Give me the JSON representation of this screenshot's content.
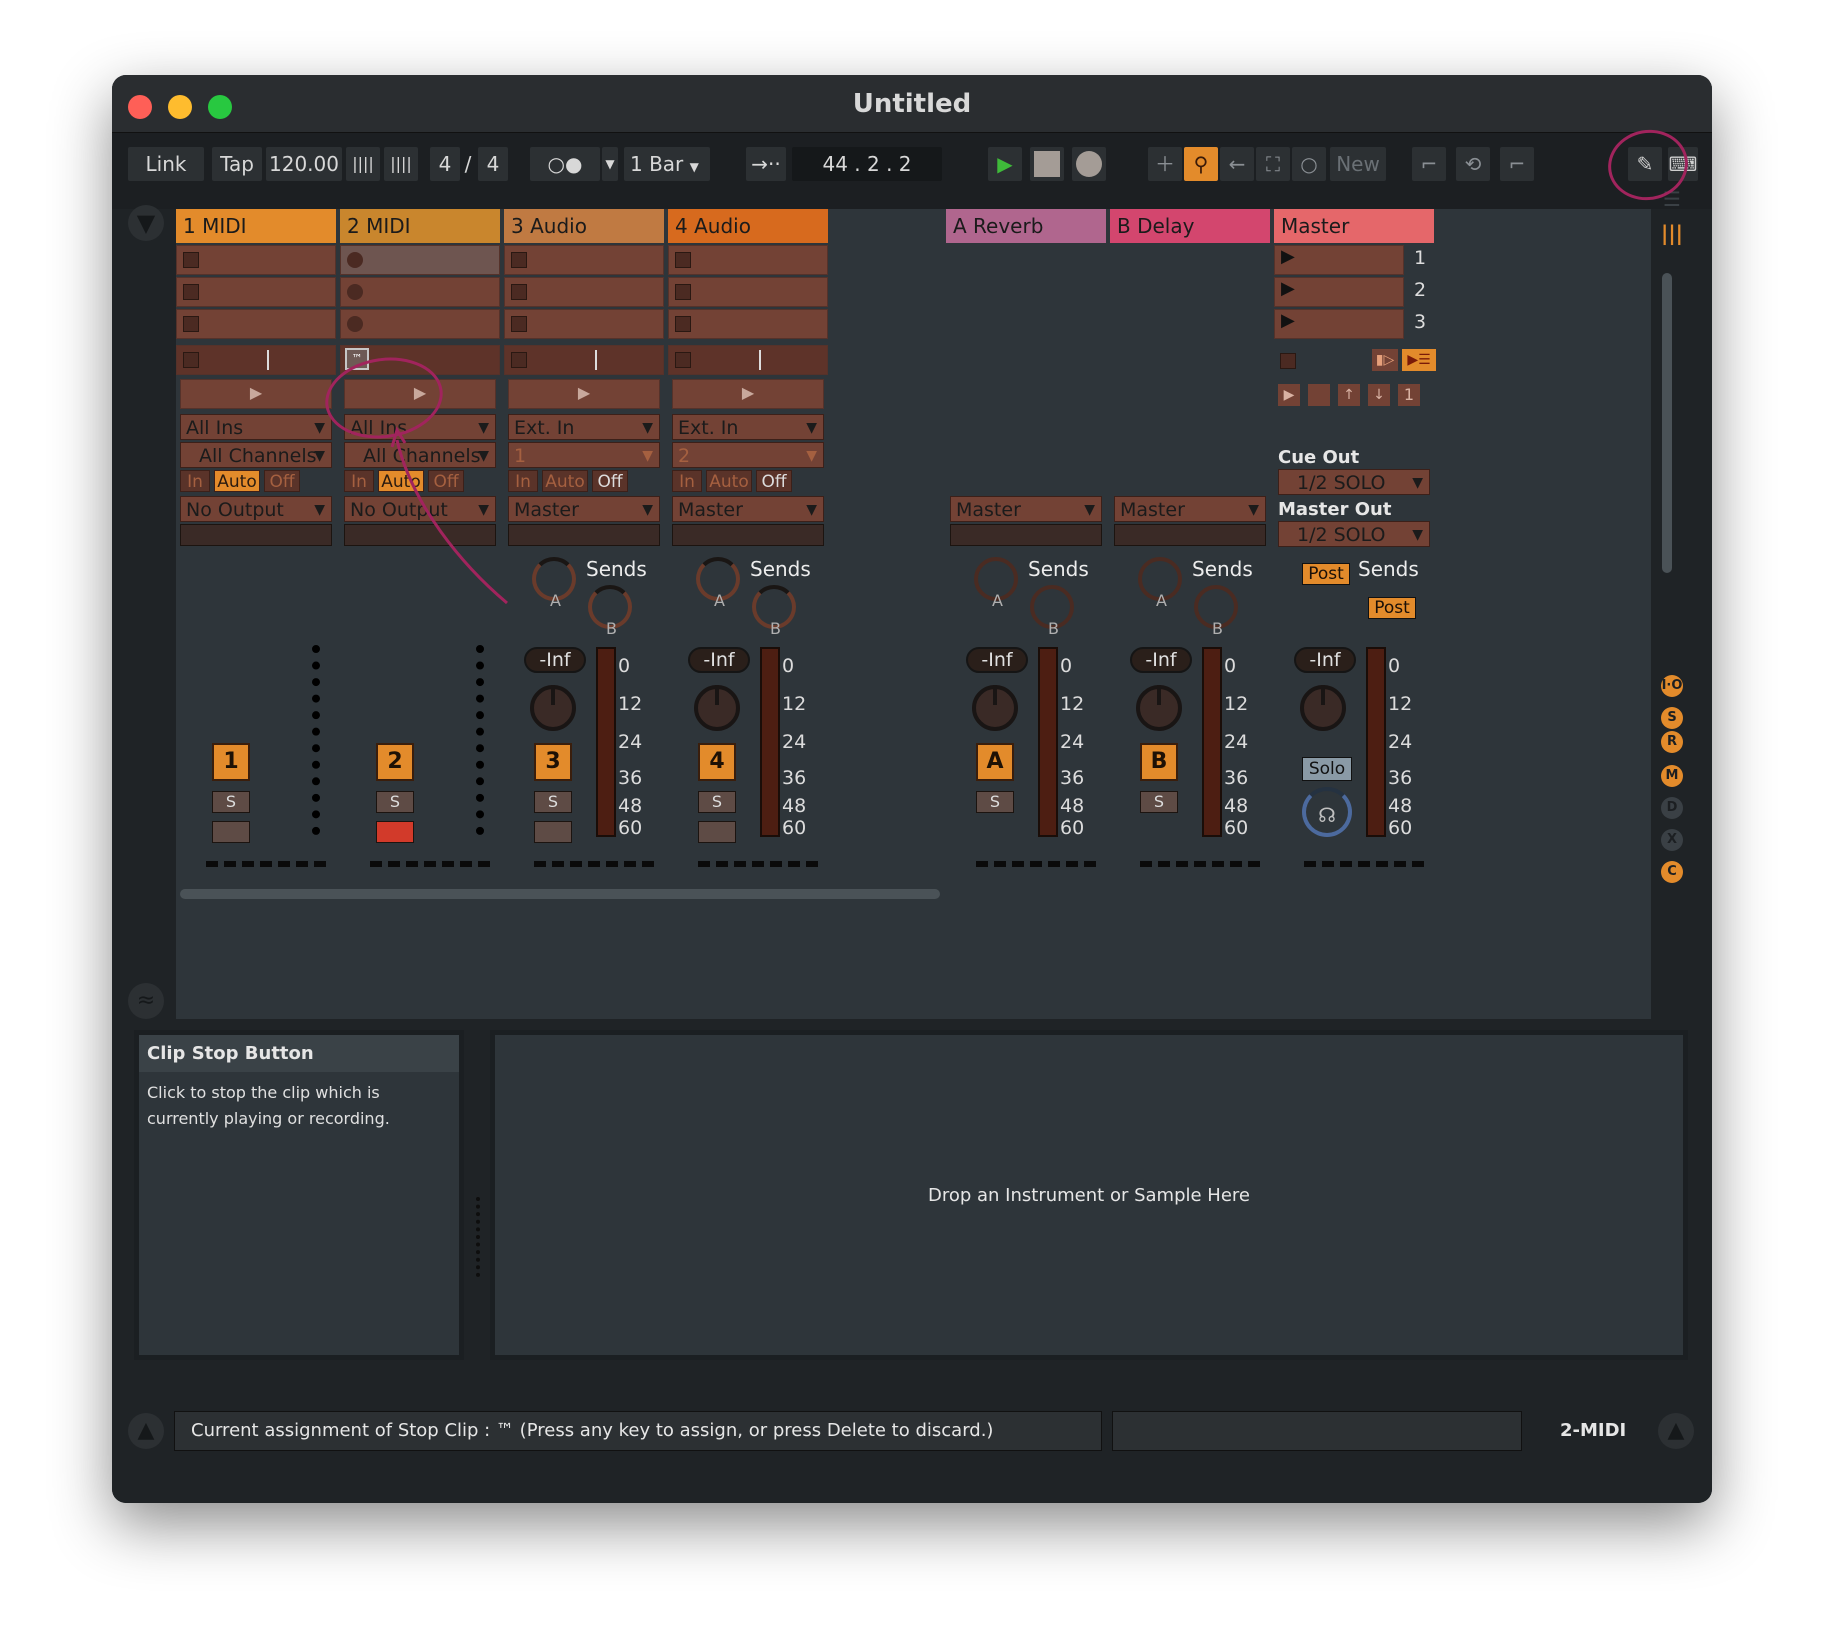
{
  "window": {
    "title": "Untitled"
  },
  "control_bar": {
    "link": "Link",
    "tap": "Tap",
    "tempo": "120.00",
    "time_sig_num": "4",
    "time_sig_sep": "/",
    "time_sig_den": "4",
    "quantize": "1 Bar",
    "position": "44 .   2 .   2",
    "new_label": "New"
  },
  "tracks": [
    {
      "name": "1 MIDI",
      "color": "#e38b2b",
      "input": "All Ins",
      "channel": "All Channels",
      "output": "No Output",
      "number": "1"
    },
    {
      "name": "2 MIDI",
      "color": "#c9862d",
      "input": "All Ins",
      "channel": "All Channels",
      "output": "No Output",
      "number": "2"
    },
    {
      "name": "3 Audio",
      "color": "#c07a42",
      "input": "Ext. In",
      "channel": "1",
      "output": "Master",
      "number": "3"
    },
    {
      "name": "4 Audio",
      "color": "#d76a1e",
      "input": "Ext. In",
      "channel": "2",
      "output": "Master",
      "number": "4"
    }
  ],
  "returns": [
    {
      "name": "A Reverb",
      "color": "#b0668e",
      "output": "Master",
      "letter": "A"
    },
    {
      "name": "B Delay",
      "color": "#d3466e",
      "output": "Master",
      "letter": "B"
    }
  ],
  "master": {
    "name": "Master",
    "color": "#e5676a",
    "scenes": [
      "1",
      "2",
      "3"
    ],
    "cue_out_label": "Cue Out",
    "cue_out": "1/2 SOLO",
    "master_out_label": "Master Out",
    "master_out": "1/2 SOLO",
    "solo": "Solo",
    "post": "Post",
    "scene_number": "1"
  },
  "labels": {
    "in": "In",
    "auto": "Auto",
    "off": "Off",
    "sends": "Sends",
    "send_a": "A",
    "send_b": "B",
    "minus_inf": "-Inf",
    "solo_s": "S",
    "tm": "™"
  },
  "scale": [
    "0",
    "12",
    "24",
    "36",
    "48",
    "60"
  ],
  "side_icons": [
    "I·O",
    "S",
    "R",
    "M",
    "D",
    "X",
    "C"
  ],
  "info_view": {
    "title": "Clip Stop Button",
    "body": "Click to stop the clip which is currently playing or recording."
  },
  "device_view": {
    "drop_text": "Drop an Instrument or Sample Here"
  },
  "status_bar": {
    "message": "Current assignment of Stop Clip : ™  (Press any key to assign, or press Delete to discard.)",
    "selected_track": "2-MIDI"
  }
}
